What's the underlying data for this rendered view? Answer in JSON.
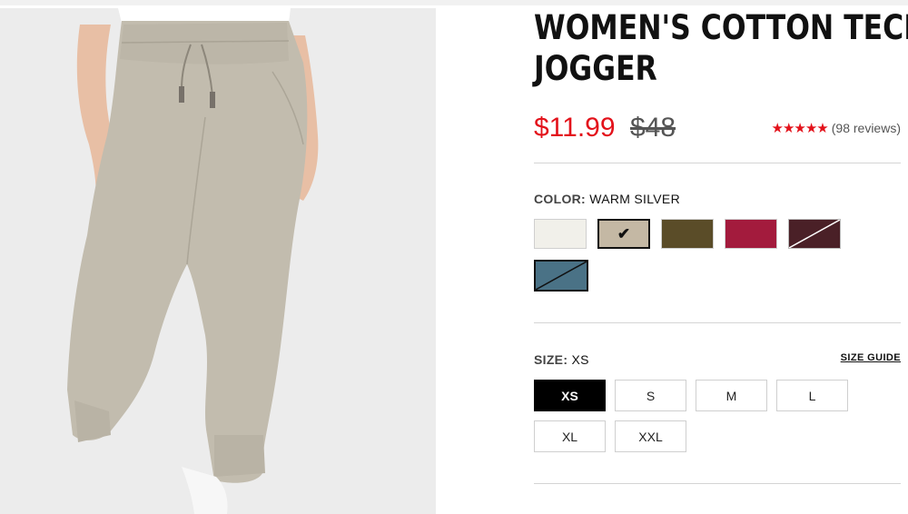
{
  "product": {
    "title_line1": "WOMEN'S COTTON TECH",
    "title_line2": "JOGGER",
    "sale_price": "$11.99",
    "original_price": "$48",
    "stars": "★★★★★",
    "reviews": "(98 reviews)",
    "image_alt": "product-photo"
  },
  "color": {
    "label": "COLOR:",
    "selected": "WARM SILVER",
    "swatches": [
      {
        "name": "white",
        "color": "#f1f0ea"
      },
      {
        "name": "warm-silver",
        "color": "#c4b8a4",
        "selected": true
      },
      {
        "name": "olive",
        "color": "#5a4c28"
      },
      {
        "name": "crimson",
        "color": "#a31b3d"
      },
      {
        "name": "plum-split",
        "color": "#4a2027"
      },
      {
        "name": "teal-split",
        "color": "#4a7286"
      }
    ],
    "check_mark": "✔"
  },
  "size": {
    "label": "SIZE:",
    "selected": "XS",
    "guide": "SIZE GUIDE",
    "options": [
      "XS",
      "S",
      "M",
      "L",
      "XL",
      "XXL"
    ]
  },
  "theme": {
    "accent": "#e3121b",
    "pants": "#c2bcae"
  }
}
